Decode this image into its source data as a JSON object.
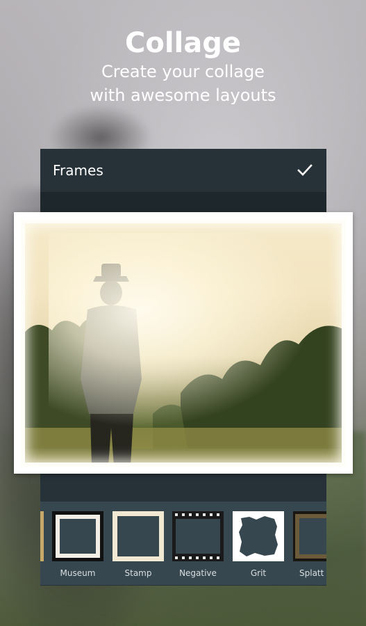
{
  "header": {
    "title": "Collage",
    "subtitle_line1": "Create your collage",
    "subtitle_line2": "with awesome layouts"
  },
  "panel": {
    "title": "Frames",
    "confirm_icon": "check-icon"
  },
  "frames": [
    {
      "label": "Museum"
    },
    {
      "label": "Stamp"
    },
    {
      "label": "Negative"
    },
    {
      "label": "Grit"
    },
    {
      "label": "Splatt"
    }
  ],
  "colors": {
    "panel": "#263238",
    "strip": "#37474f"
  }
}
